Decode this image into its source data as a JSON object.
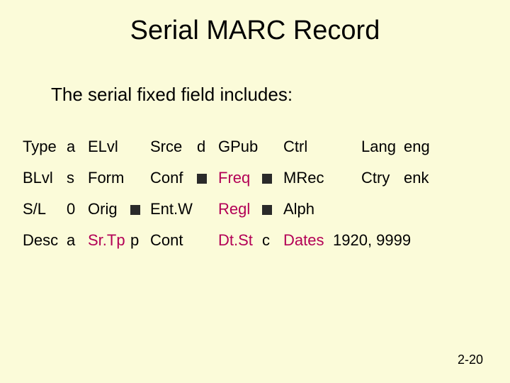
{
  "title": "Serial MARC Record",
  "subtitle": "The serial fixed field includes:",
  "page_number": "2-20",
  "rows": [
    {
      "c1l": "Type",
      "c1v": "a",
      "c2l": "ELvl",
      "c2v": "",
      "c3l": "Srce",
      "c3v": "d",
      "c4l": "GPub",
      "c4v": "",
      "c5l": "Ctrl",
      "c5v": "",
      "c6l": "Lang",
      "c6v": "eng",
      "h4": false,
      "v4blk": false
    },
    {
      "c1l": "BLvl",
      "c1v": "s",
      "c2l": "Form",
      "c2v": "",
      "c3l": "Conf",
      "c3v": "■",
      "c4l": "Freq",
      "c4v": "■",
      "c5l": "MRec",
      "c5v": "",
      "c6l": "Ctry",
      "c6v": "enk",
      "h4": true,
      "v3blk": true,
      "v4blk": true
    },
    {
      "c1l": "S/L",
      "c1v": "0",
      "c2l": "Orig",
      "c2v": "■",
      "c3l": "Ent.W",
      "c3v": "",
      "c4l": "Regl",
      "c4v": "■",
      "c5l": "Alph",
      "c5v": "",
      "c6l": "",
      "c6v": "",
      "h4": true,
      "v2blk": true,
      "v4blk": true
    },
    {
      "c1l": "Desc",
      "c1v": "a",
      "c2l": "Sr.Tp",
      "c2v": "p",
      "c3l": "Cont",
      "c3v": "",
      "c4l": "Dt.St",
      "c4v": "c",
      "c5l": "Dates",
      "c5v": "1920, 9999",
      "c6l": "",
      "c6v": "",
      "h2": true,
      "h4": true,
      "h5": true
    }
  ]
}
